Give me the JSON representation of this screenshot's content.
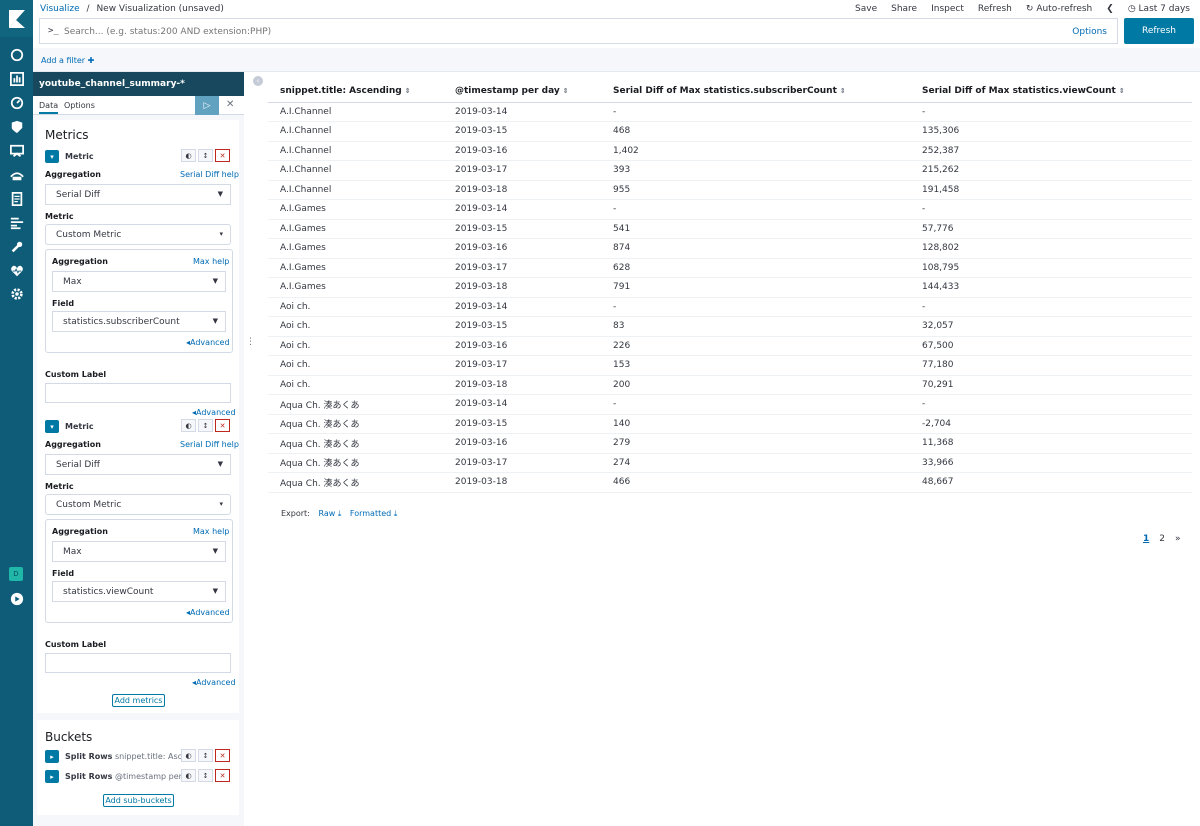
{
  "nav": {
    "icons": [
      "kibana-logo-icon",
      "discover-icon",
      "visualize-icon",
      "dashboard-icon",
      "timelion-icon",
      "canvas-icon",
      "maps-icon",
      "infrastructure-icon",
      "logs-icon",
      "apm-icon",
      "dev-tools-icon",
      "monitoring-icon",
      "management-icon"
    ],
    "avatar": "D"
  },
  "breadcrumb": {
    "root": "Visualize",
    "sep": "/",
    "current": "New Visualization (unsaved)"
  },
  "topnav": {
    "save": "Save",
    "share": "Share",
    "inspect": "Inspect",
    "refresh": "Refresh",
    "auto_refresh": "Auto-refresh",
    "time_range": "Last 7 days"
  },
  "query": {
    "prompt": ">_",
    "placeholder": "Search... (e.g. status:200 AND extension:PHP)",
    "options": "Options",
    "refresh_button": "Refresh"
  },
  "filter": {
    "add_filter": "Add a filter"
  },
  "sidebar": {
    "index_pattern": "youtube_channel_summary-*",
    "tabs": [
      "Data",
      "Options"
    ],
    "metrics_title": "Metrics",
    "metrics": [
      {
        "label": "Metric",
        "aggregation_label": "Aggregation",
        "aggregation_help": "Serial Diff help",
        "aggregation": "Serial Diff",
        "metric_label": "Metric",
        "metric": "Custom Metric",
        "sub_aggregation_label": "Aggregation",
        "sub_help": "Max help",
        "sub_aggregation": "Max",
        "field_label": "Field",
        "field": "statistics.subscriberCount",
        "advanced": "Advanced",
        "custom_label": "Custom Label",
        "advanced2": "Advanced"
      },
      {
        "label": "Metric",
        "aggregation_label": "Aggregation",
        "aggregation_help": "Serial Diff help",
        "aggregation": "Serial Diff",
        "metric_label": "Metric",
        "metric": "Custom Metric",
        "sub_aggregation_label": "Aggregation",
        "sub_help": "Max help",
        "sub_aggregation": "Max",
        "field_label": "Field",
        "field": "statistics.viewCount",
        "advanced": "Advanced",
        "custom_label": "Custom Label",
        "advanced2": "Advanced"
      }
    ],
    "add_metrics": "Add metrics",
    "buckets_title": "Buckets",
    "buckets": [
      {
        "type": "Split Rows",
        "desc": "snippet.title: Asce..."
      },
      {
        "type": "Split Rows",
        "desc": "@timestamp per ..."
      }
    ],
    "add_sub_buckets": "Add sub-buckets"
  },
  "table": {
    "columns": [
      "snippet.title: Ascending",
      "@timestamp per day",
      "Serial Diff of Max statistics.subscriberCount",
      "Serial Diff of Max statistics.viewCount"
    ],
    "rows": [
      [
        "A.I.Channel",
        "2019-03-14",
        "-",
        "-"
      ],
      [
        "A.I.Channel",
        "2019-03-15",
        "468",
        "135,306"
      ],
      [
        "A.I.Channel",
        "2019-03-16",
        "1,402",
        "252,387"
      ],
      [
        "A.I.Channel",
        "2019-03-17",
        "393",
        "215,262"
      ],
      [
        "A.I.Channel",
        "2019-03-18",
        "955",
        "191,458"
      ],
      [
        "A.I.Games",
        "2019-03-14",
        "-",
        "-"
      ],
      [
        "A.I.Games",
        "2019-03-15",
        "541",
        "57,776"
      ],
      [
        "A.I.Games",
        "2019-03-16",
        "874",
        "128,802"
      ],
      [
        "A.I.Games",
        "2019-03-17",
        "628",
        "108,795"
      ],
      [
        "A.I.Games",
        "2019-03-18",
        "791",
        "144,433"
      ],
      [
        "Aoi ch.",
        "2019-03-14",
        "-",
        "-"
      ],
      [
        "Aoi ch.",
        "2019-03-15",
        "83",
        "32,057"
      ],
      [
        "Aoi ch.",
        "2019-03-16",
        "226",
        "67,500"
      ],
      [
        "Aoi ch.",
        "2019-03-17",
        "153",
        "77,180"
      ],
      [
        "Aoi ch.",
        "2019-03-18",
        "200",
        "70,291"
      ],
      [
        "Aqua Ch. 湊あくあ",
        "2019-03-14",
        "-",
        "-"
      ],
      [
        "Aqua Ch. 湊あくあ",
        "2019-03-15",
        "140",
        "-2,704"
      ],
      [
        "Aqua Ch. 湊あくあ",
        "2019-03-16",
        "279",
        "11,368"
      ],
      [
        "Aqua Ch. 湊あくあ",
        "2019-03-17",
        "274",
        "33,966"
      ],
      [
        "Aqua Ch. 湊あくあ",
        "2019-03-18",
        "466",
        "48,667"
      ]
    ]
  },
  "export": {
    "label": "Export:",
    "raw": "Raw",
    "formatted": "Formatted"
  },
  "pager": {
    "pages": [
      "1",
      "2"
    ],
    "next": "»"
  }
}
